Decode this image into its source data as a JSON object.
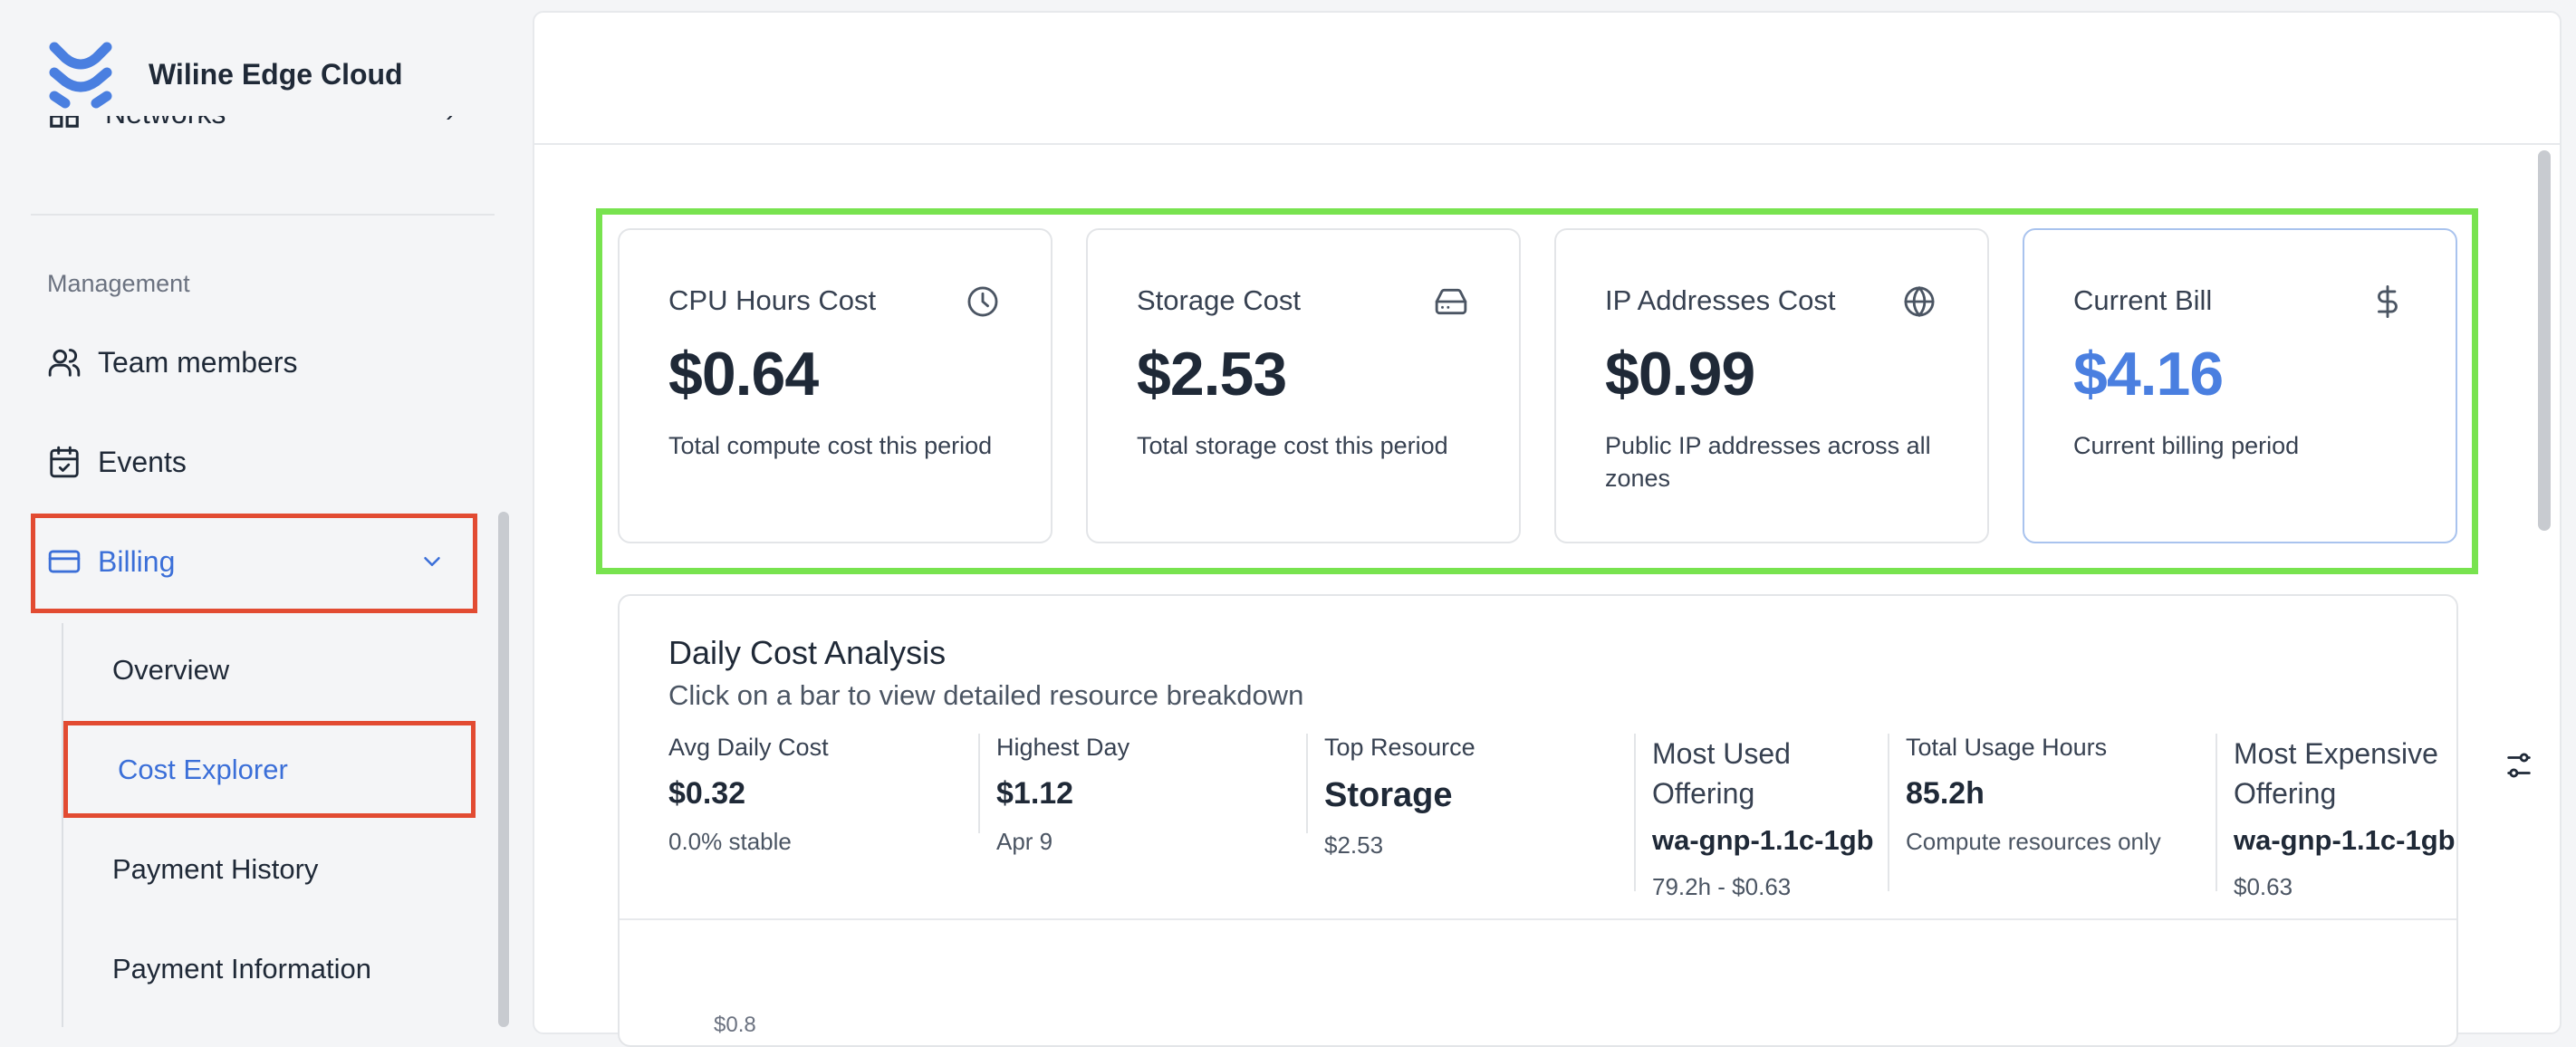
{
  "brand": {
    "name": "Wiline Edge Cloud"
  },
  "sidebar": {
    "partial_item": {
      "label": "Networks"
    },
    "section_title": "Management",
    "items": [
      {
        "label": "Team members",
        "icon": "users-icon"
      },
      {
        "label": "Events",
        "icon": "calendar-check-icon"
      },
      {
        "label": "Billing",
        "icon": "credit-card-icon",
        "active": true
      }
    ],
    "billing_subitems": [
      {
        "label": "Overview"
      },
      {
        "label": "Cost Explorer",
        "active": true
      },
      {
        "label": "Payment History"
      },
      {
        "label": "Payment Information"
      }
    ]
  },
  "cards": [
    {
      "title": "CPU Hours Cost",
      "icon": "clock-icon",
      "value": "$0.64",
      "desc": "Total compute cost this period"
    },
    {
      "title": "Storage Cost",
      "icon": "hard-drive-icon",
      "value": "$2.53",
      "desc": "Total storage cost this period"
    },
    {
      "title": "IP Addresses Cost",
      "icon": "globe-icon",
      "value": "$0.99",
      "desc": "Public IP addresses across all zones"
    },
    {
      "title": "Current Bill",
      "icon": "dollar-icon",
      "value": "$4.16",
      "desc": "Current billing period"
    }
  ],
  "analysis": {
    "title": "Daily Cost Analysis",
    "subtitle": "Click on a bar to view detailed resource breakdown",
    "metrics": [
      {
        "label": "Avg Daily Cost",
        "value": "$0.32",
        "sub": "0.0% stable"
      },
      {
        "label": "Highest Day",
        "value": "$1.12",
        "sub": "Apr 9"
      },
      {
        "label": "Top Resource",
        "value": "Storage",
        "sub": "$2.53"
      },
      {
        "label": "Most Used Offering",
        "value": "wa-gnp-1.1c-1gb",
        "sub": "79.2h - $0.63"
      },
      {
        "label": "Total Usage Hours",
        "value": "85.2h",
        "sub": "Compute resources only"
      },
      {
        "label": "Most Expensive Offering",
        "value": "wa-gnp-1.1c-1gb",
        "sub": "$0.63"
      }
    ],
    "chart_axis_partial": "$0.8"
  },
  "colors": {
    "accent": "#3b6fd8",
    "highlight_green": "#78e34f",
    "highlight_red": "#e24b32"
  }
}
